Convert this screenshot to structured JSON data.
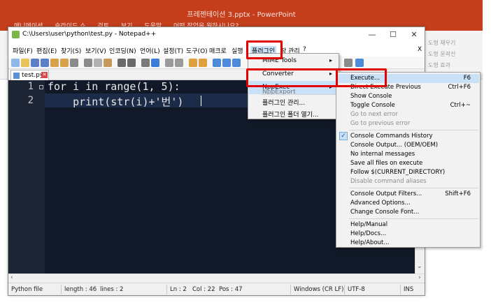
{
  "powerpoint": {
    "title": "프레젠테이션 3.pptx  -  PowerPoint",
    "menu": [
      "애니메이션",
      "슬라이드 쇼",
      "검토",
      "보기",
      "도움말",
      "어떤 작업을 원하시나요?"
    ],
    "ribbon_items": [
      "도형 채우기",
      "도형 윤곽선",
      "도형 효과"
    ]
  },
  "window": {
    "title": "C:\\Users\\user\\python\\test.py - Notepad++",
    "close_x": "X"
  },
  "menubar": {
    "items": [
      "파일(F)",
      "편집(E)",
      "찾기(S)",
      "보기(V)",
      "인코딩(N)",
      "언어(L)",
      "설정(T)",
      "도구(O)",
      "매크로",
      "실행",
      "플러그인",
      "창 관리",
      "?"
    ]
  },
  "tab": {
    "label": "test.py"
  },
  "editor": {
    "lines": [
      {
        "number": "1",
        "text": "for i in range(1, 5):"
      },
      {
        "number": "2",
        "text": "    print(str(i)+'번')"
      }
    ]
  },
  "status": {
    "file_type": "Python file",
    "length": "length : 46",
    "lines": "lines : 2",
    "ln": "Ln : 2",
    "col": "Col : 22",
    "pos": "Pos : 47",
    "eol": "Windows (CR LF)",
    "encoding": "UTF-8",
    "mode": "INS"
  },
  "plugins_menu": {
    "items": [
      {
        "label": "MIME Tools",
        "submenu": true
      },
      {
        "label": "Converter",
        "submenu": true
      },
      {
        "label": "NppExec",
        "submenu": true,
        "selected": true
      },
      {
        "label": "NppExport",
        "submenu": true
      },
      {
        "label": "플러그인 관리...",
        "submenu": false
      },
      {
        "label": "플러그인 폴더 열기...",
        "submenu": false
      }
    ]
  },
  "nppexec_menu": {
    "groups": [
      [
        {
          "label": "Execute...",
          "shortcut": "F6",
          "selected": true
        },
        {
          "label": "Direct Execute Previous",
          "shortcut": "Ctrl+F6"
        },
        {
          "label": "Show Console",
          "shortcut": ""
        },
        {
          "label": "Toggle Console",
          "shortcut": "Ctrl+~"
        },
        {
          "label": "Go to next error",
          "shortcut": "",
          "disabled": true
        },
        {
          "label": "Go to previous error",
          "shortcut": "",
          "disabled": true
        }
      ],
      [
        {
          "label": "Console Commands History",
          "shortcut": "",
          "checked": true
        },
        {
          "label": "Console Output... (OEM/OEM)",
          "shortcut": ""
        },
        {
          "label": "No internal messages",
          "shortcut": ""
        },
        {
          "label": "Save all files on execute",
          "shortcut": ""
        },
        {
          "label": "Follow $(CURRENT_DIRECTORY)",
          "shortcut": ""
        },
        {
          "label": "Disable command aliases",
          "shortcut": "",
          "disabled": true
        }
      ],
      [
        {
          "label": "Console Output Filters...",
          "shortcut": "Shift+F6"
        },
        {
          "label": "Advanced Options...",
          "shortcut": ""
        },
        {
          "label": "Change Console Font...",
          "shortcut": ""
        }
      ],
      [
        {
          "label": "Help/Manual",
          "shortcut": ""
        },
        {
          "label": "Help/Docs...",
          "shortcut": ""
        },
        {
          "label": "Help/About...",
          "shortcut": ""
        }
      ]
    ]
  },
  "colors": {
    "highlight_box": "#e20000",
    "powerpoint_brand": "#c43e1c",
    "editor_bg": "#111827",
    "menu_selection": "#c9e1f7"
  }
}
